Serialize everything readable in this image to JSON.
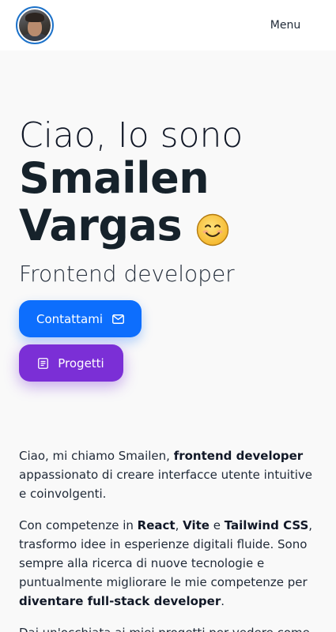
{
  "header": {
    "menu_label": "Menu"
  },
  "hero": {
    "greeting": "Ciao, Io sono",
    "name_line1": "Smailen",
    "name_line2": "Vargas",
    "emoji": "😊",
    "role": "Frontend developer",
    "contact_label": "Contattami",
    "contact_icon": "mail-icon",
    "projects_label": "Progetti",
    "projects_icon": "document-icon"
  },
  "about": {
    "p1": {
      "a": "Ciao, mi chiamo Smailen, ",
      "b": "frontend developer",
      "c": " appassionato di creare interfacce utente intuitive e coinvolgenti."
    },
    "p2": {
      "a": "Con competenze in ",
      "b": "React",
      "c": ", ",
      "d": "Vite",
      "e": " e ",
      "f": "Tailwind CSS",
      "g": ", trasformo idee in esperienze digitali fluide. Sono sempre alla ricerca di nuove tecnologie e puntualmente migliorare le mie competenze per ",
      "h": "diventare full-stack developer",
      "i": "."
    },
    "p3": {
      "a": "Dai un'occhiata ai miei progetti per vedere come"
    }
  },
  "colors": {
    "contact_button": "#0d6efd",
    "projects_button": "#7b2fd6",
    "avatar_ring": "#1d72c9",
    "background": "#f9f9f9"
  }
}
